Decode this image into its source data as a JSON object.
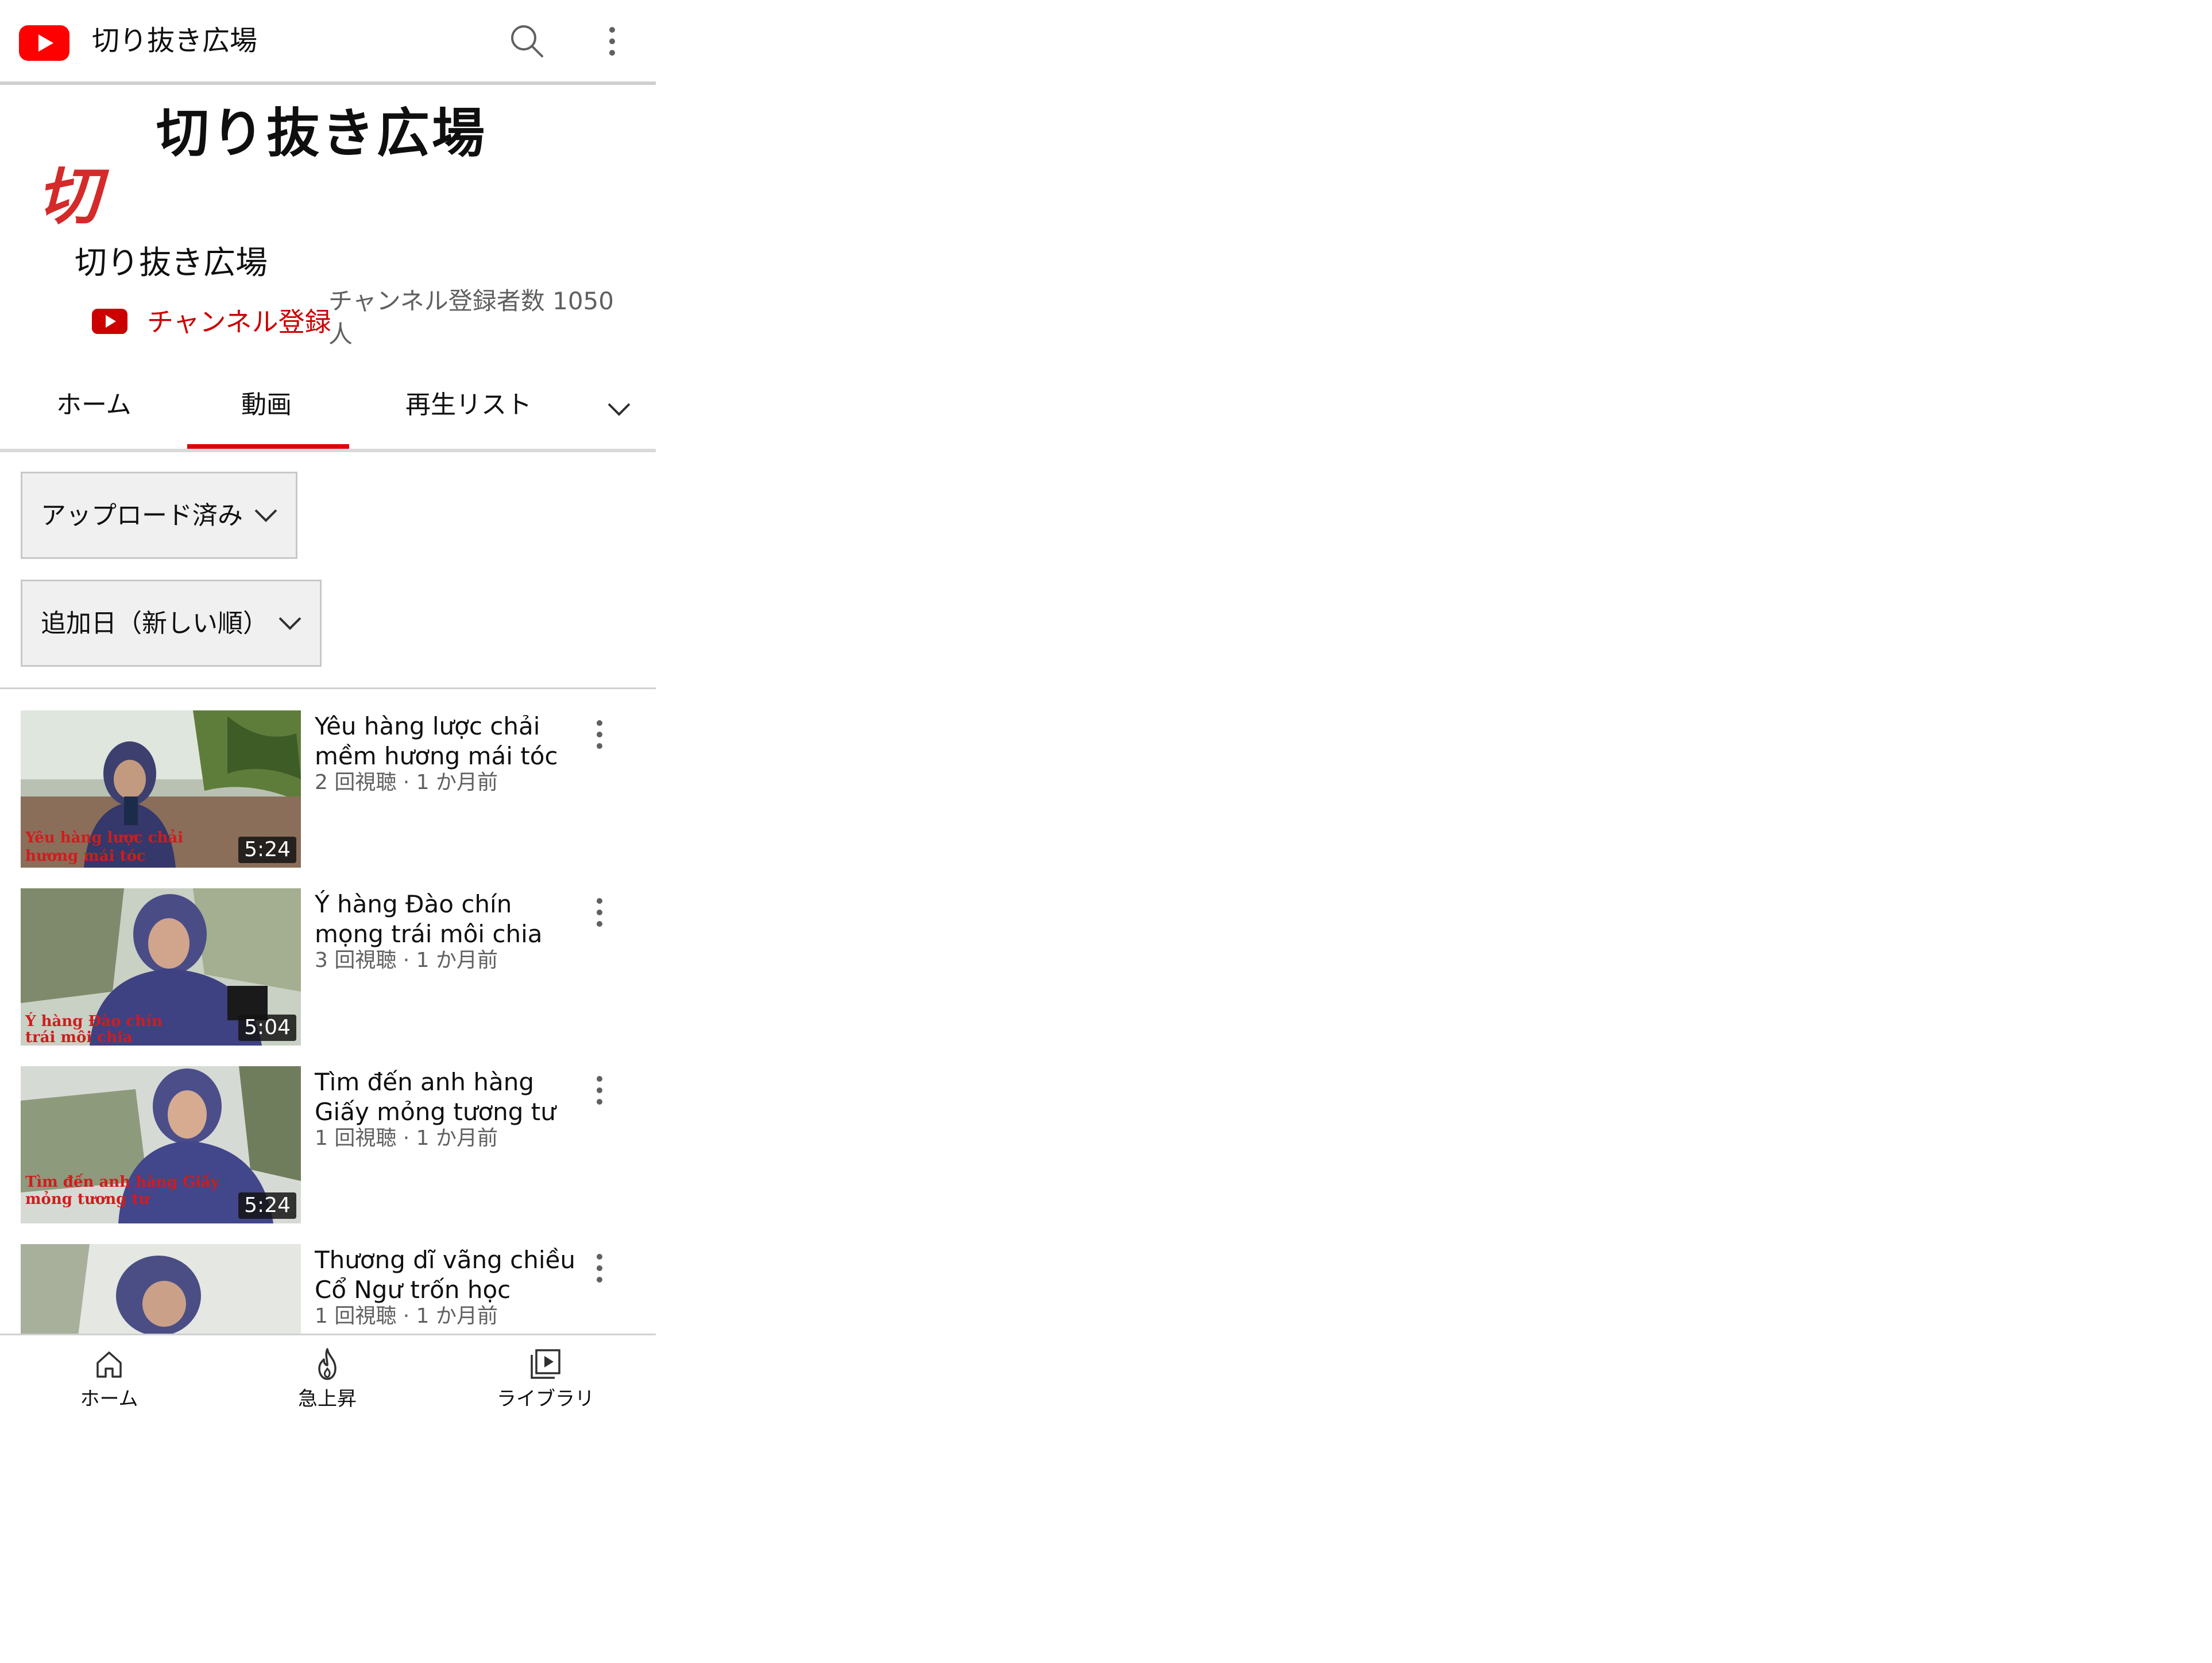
{
  "appbar": {
    "title": "切り抜き広場",
    "logo_icon": "youtube-logo-icon",
    "search_icon": "search-icon",
    "more_icon": "more-vert-icon",
    "brand_color": "#ff0000"
  },
  "banner": {
    "text": "切り抜き広場",
    "mark": "切"
  },
  "channel": {
    "name": "切り抜き広場",
    "subscribe_label": "チャンネル登録",
    "subscriber_count": "チャンネル登録者数 1050 人"
  },
  "tabs": [
    {
      "label": "ホーム",
      "selected": false
    },
    {
      "label": "動画",
      "selected": true
    },
    {
      "label": "再生リスト",
      "selected": false
    }
  ],
  "filters": {
    "upload": "アップロード済み",
    "sort": "追加日（新しい順）"
  },
  "videos": [
    {
      "title": "Yêu hàng lược chải mềm hương mái tóc",
      "meta": "2 回視聴 · 1 か月前",
      "duration": "5:24",
      "overlay_line1": "Yêu hàng lược chải",
      "overlay_line2": "hương mái tóc"
    },
    {
      "title": "Ý hàng Đào chín mọng trái môi chia",
      "meta": "3 回視聴 · 1 か月前",
      "duration": "5:04",
      "overlay_line1": "Ý hàng Đào chín",
      "overlay_line2": "trái môi chia"
    },
    {
      "title": "Tìm đến anh hàng Giấy mỏng tương tư",
      "meta": "1 回視聴 · 1 か月前",
      "duration": "5:24",
      "overlay_line1": "Tìm đến anh hàng Giấy",
      "overlay_line2": "mỏng tương tư"
    },
    {
      "title": "Thương dĩ vãng chiều Cổ Ngư trốn học",
      "meta": "1 回視聴 · 1 か月前",
      "duration": "",
      "overlay_line1": "",
      "overlay_line2": ""
    }
  ],
  "bottom_nav": [
    {
      "label": "ホーム",
      "icon": "home-icon"
    },
    {
      "label": "急上昇",
      "icon": "trending-fire-icon"
    },
    {
      "label": "ライブラリ",
      "icon": "library-icon"
    }
  ]
}
